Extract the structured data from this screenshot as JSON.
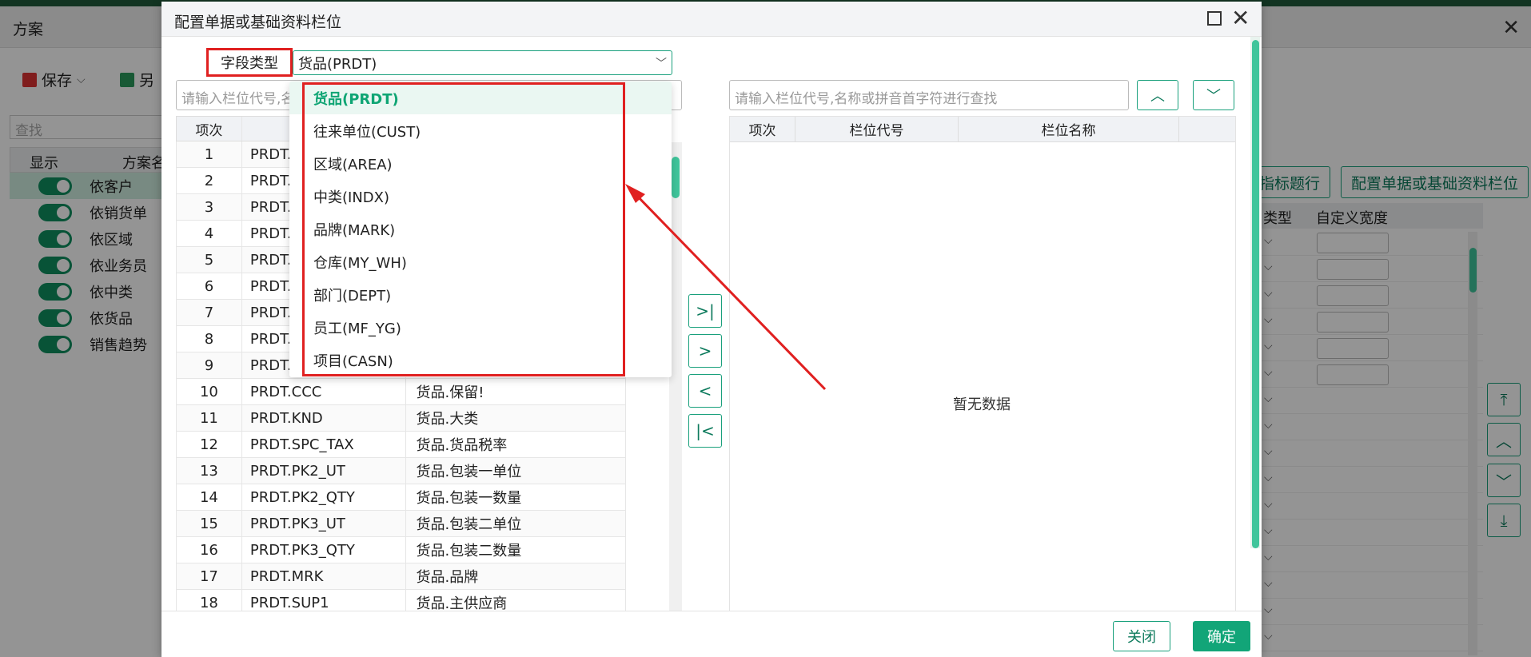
{
  "background": {
    "title": "方案",
    "toolbar": {
      "save_label": "保存",
      "saveas_label": "另"
    },
    "search_placeholder": "查找",
    "table_headers": {
      "show": "显示",
      "plan_name": "方案名"
    },
    "rows": [
      "依客户",
      "依销货单",
      "依区域",
      "依业务员",
      "依中类",
      "依货品",
      "销售趋势"
    ],
    "right_buttons": {
      "title_row": "指标题行",
      "config": "配置单据或基础资料栏位"
    },
    "right_headers": {
      "type": "类型",
      "custom_width": "自定义宽度"
    }
  },
  "dialog": {
    "title": "配置单据或基础资料栏位",
    "field_type_label": "字段类型",
    "field_type_value": "货品(PRDT)",
    "left_search_placeholder": "请输入栏位代号,名",
    "right_search_placeholder": "请输入栏位代号,名称或拼音首字符进行查找",
    "left_headers": {
      "index": "项次"
    },
    "left_rows": [
      {
        "no": "1",
        "code": "PRDT.",
        "name": ""
      },
      {
        "no": "2",
        "code": "PRDT.",
        "name": ""
      },
      {
        "no": "3",
        "code": "PRDT.",
        "name": ""
      },
      {
        "no": "4",
        "code": "PRDT.",
        "name": ""
      },
      {
        "no": "5",
        "code": "PRDT.",
        "name": ""
      },
      {
        "no": "6",
        "code": "PRDT.",
        "name": ""
      },
      {
        "no": "7",
        "code": "PRDT.",
        "name": ""
      },
      {
        "no": "8",
        "code": "PRDT.",
        "name": ""
      },
      {
        "no": "9",
        "code": "PRDT.",
        "name": ""
      },
      {
        "no": "10",
        "code": "PRDT.CCC",
        "name": "货品.保留!"
      },
      {
        "no": "11",
        "code": "PRDT.KND",
        "name": "货品.大类"
      },
      {
        "no": "12",
        "code": "PRDT.SPC_TAX",
        "name": "货品.货品税率"
      },
      {
        "no": "13",
        "code": "PRDT.PK2_UT",
        "name": "货品.包装一单位"
      },
      {
        "no": "14",
        "code": "PRDT.PK2_QTY",
        "name": "货品.包装一数量"
      },
      {
        "no": "15",
        "code": "PRDT.PK3_UT",
        "name": "货品.包装二单位"
      },
      {
        "no": "16",
        "code": "PRDT.PK3_QTY",
        "name": "货品.包装二数量"
      },
      {
        "no": "17",
        "code": "PRDT.MRK",
        "name": "货品.品牌"
      },
      {
        "no": "18",
        "code": "PRDT.SUP1",
        "name": "货品.主供应商"
      }
    ],
    "right_headers": {
      "index": "项次",
      "code": "栏位代号",
      "name": "栏位名称"
    },
    "no_data": "暂无数据",
    "buttons": {
      "close": "关闭",
      "ok": "确定"
    },
    "dropdown_options": [
      "货品(PRDT)",
      "往来单位(CUST)",
      "区域(AREA)",
      "中类(INDX)",
      "品牌(MARK)",
      "仓库(MY_WH)",
      "部门(DEPT)",
      "员工(MF_YG)",
      "项目(CASN)"
    ],
    "annotation_color": "#e02020",
    "accent_color": "#12a578"
  }
}
